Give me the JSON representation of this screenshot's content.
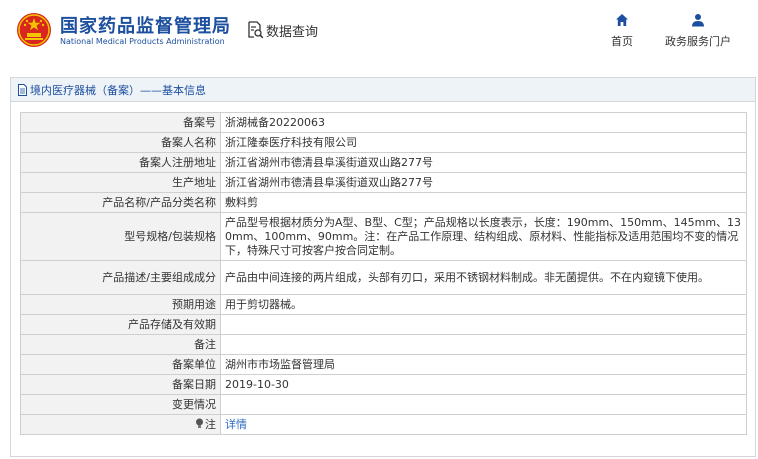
{
  "header": {
    "brand_cn": "国家药品监督管理局",
    "brand_en": "National Medical Products Administration",
    "query_label": "数据查询",
    "nav": [
      {
        "label": "首页",
        "icon": "home-icon"
      },
      {
        "label": "政务服务门户",
        "icon": "user-icon"
      }
    ]
  },
  "panel": {
    "title": "境内医疗器械（备案）——基本信息"
  },
  "rows": [
    {
      "label": "备案号",
      "value": "浙湖械备20220063"
    },
    {
      "label": "备案人名称",
      "value": "浙江隆泰医疗科技有限公司"
    },
    {
      "label": "备案人注册地址",
      "value": "浙江省湖州市德清县阜溪街道双山路277号"
    },
    {
      "label": "生产地址",
      "value": "浙江省湖州市德清县阜溪街道双山路277号"
    },
    {
      "label": "产品名称/产品分类名称",
      "value": "敷料剪"
    },
    {
      "label": "型号规格/包装规格",
      "value": "产品型号根据材质分为A型、B型、C型；产品规格以长度表示，长度：190mm、150mm、145mm、130mm、100mm、90mm。注：在产品工作原理、结构组成、原材料、性能指标及适用范围均不变的情况下，特殊尺寸可按客户按合同定制。"
    },
    {
      "label": "产品描述/主要组成成分",
      "value": "产品由中间连接的两片组成，头部有刃口，采用不锈钢材料制成。非无菌提供。不在内窥镜下使用。"
    },
    {
      "label": "预期用途",
      "value": "用于剪切器械。"
    },
    {
      "label": "产品存储及有效期",
      "value": ""
    },
    {
      "label": "备注",
      "value": ""
    },
    {
      "label": "备案单位",
      "value": "湖州市市场监督管理局"
    },
    {
      "label": "备案日期",
      "value": "2019-10-30"
    },
    {
      "label": "变更情况",
      "value": ""
    }
  ],
  "note_row": {
    "label": "注",
    "link": "详情",
    "icon": "lightbulb-icon"
  },
  "colors": {
    "brand_blue": "#1d4fa0",
    "link_blue": "#2a6bc2",
    "emblem_red": "#d7261e",
    "emblem_gold": "#f5c400"
  }
}
